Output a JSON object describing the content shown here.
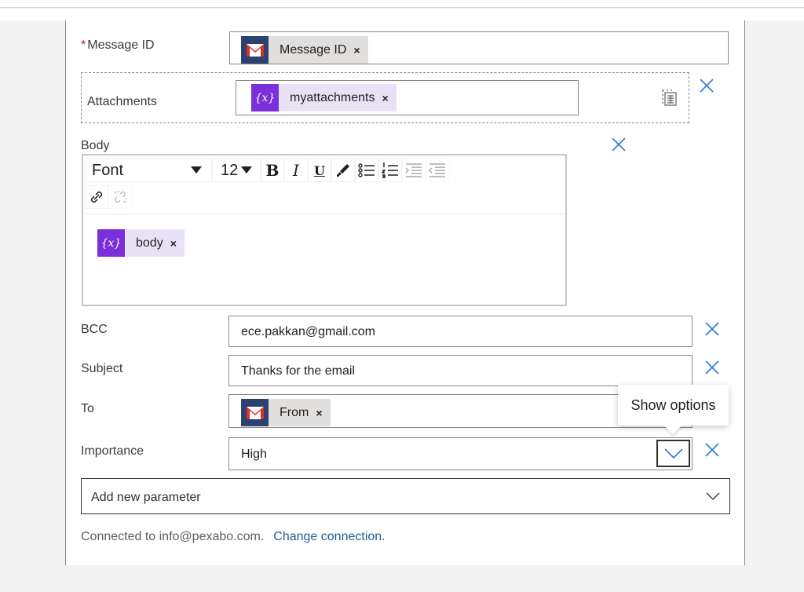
{
  "message_id": {
    "label": "Message ID",
    "required_marker": "*",
    "token": {
      "label": "Message ID",
      "close": "×",
      "icon": "gmail-icon"
    }
  },
  "attachments": {
    "label": "Attachments",
    "token": {
      "icon_text": "{x}",
      "label": "myattachments",
      "close": "×"
    }
  },
  "body": {
    "label": "Body",
    "toolbar": {
      "font": "Font",
      "size": "12",
      "bold": "B",
      "italic": "I",
      "underline": "U"
    },
    "token": {
      "icon_text": "{x}",
      "label": "body",
      "close": "×"
    }
  },
  "bcc": {
    "label": "BCC",
    "value": "ece.pakkan@gmail.com"
  },
  "subject": {
    "label": "Subject",
    "value": "Thanks for the email"
  },
  "to": {
    "label": "To",
    "token": {
      "label": "From",
      "close": "×",
      "icon": "gmail-icon"
    }
  },
  "importance": {
    "label": "Importance",
    "value": "High"
  },
  "tooltip": {
    "text": "Show options"
  },
  "add_param": {
    "label": "Add new parameter"
  },
  "footer": {
    "connected": "Connected to info@pexabo.com.",
    "change_link": "Change connection."
  },
  "colors": {
    "accent": "#2b7cd3",
    "gmail_bg": "#2c4170",
    "expr_bg": "#7b2fd8",
    "expr_token_bg": "#e9e2f7",
    "token_bg": "#e1dfdd"
  }
}
